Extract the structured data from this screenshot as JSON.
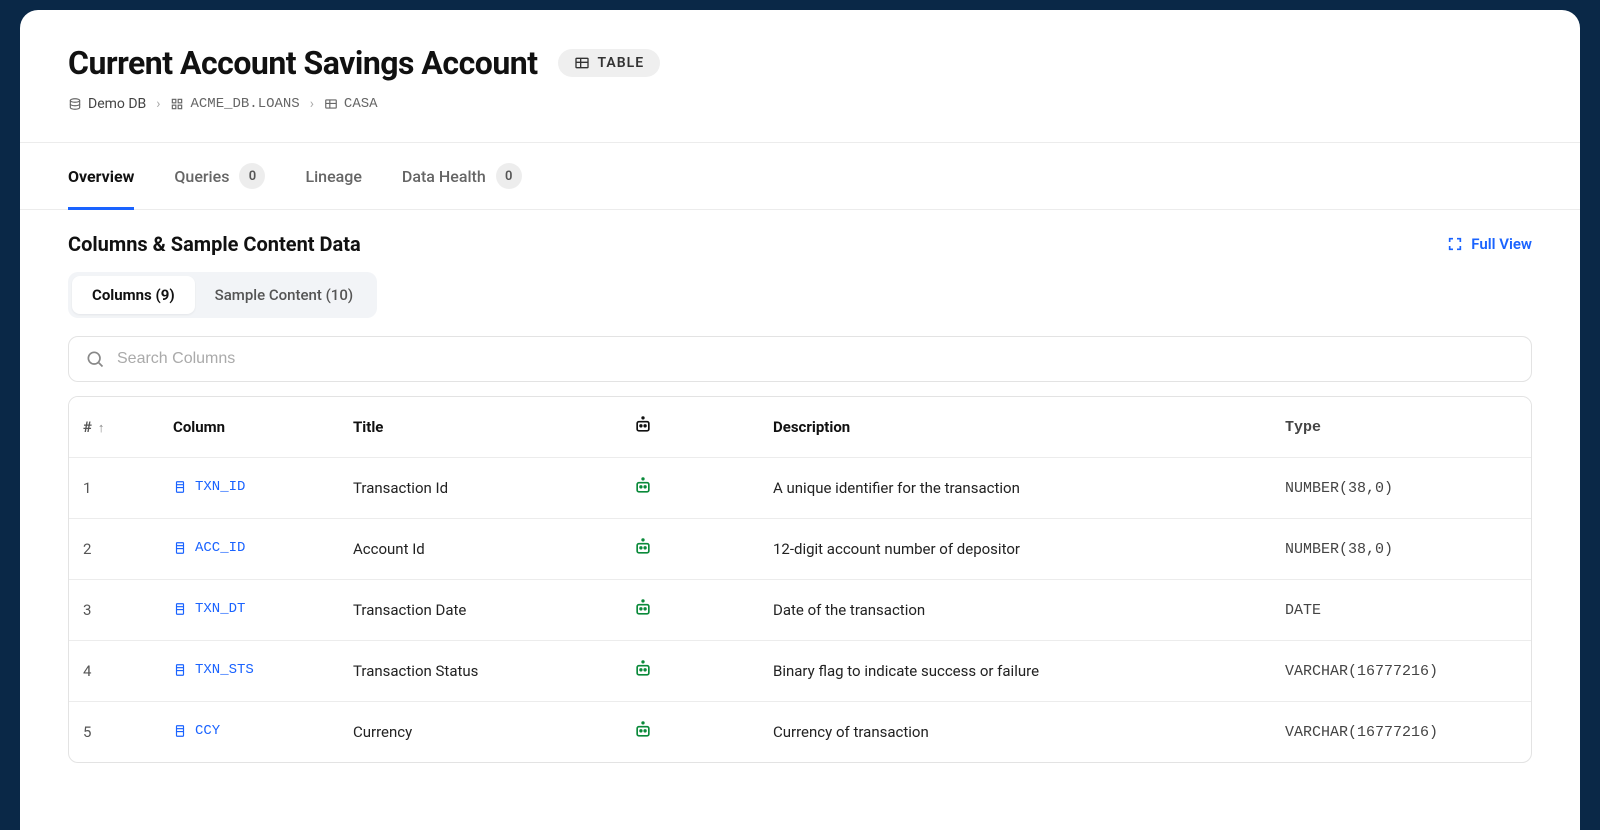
{
  "header": {
    "title": "Current Account Savings Account",
    "badge_label": "TABLE"
  },
  "breadcrumb": {
    "db": "Demo DB",
    "schema": "ACME_DB.LOANS",
    "table": "CASA"
  },
  "tabs": {
    "overview": "Overview",
    "queries": "Queries",
    "queries_count": "0",
    "lineage": "Lineage",
    "data_health": "Data Health",
    "data_health_count": "0"
  },
  "section": {
    "title": "Columns & Sample Content Data",
    "full_view": "Full View",
    "subtab_columns": "Columns (9)",
    "subtab_sample": "Sample Content (10)",
    "search_placeholder": "Search Columns"
  },
  "table": {
    "headers": {
      "num": "#",
      "column": "Column",
      "title": "Title",
      "description": "Description",
      "type": "Type"
    },
    "rows": [
      {
        "num": "1",
        "name": "TXN_ID",
        "title": "Transaction Id",
        "desc": "A unique identifier for the transaction",
        "type": "NUMBER(38,0)"
      },
      {
        "num": "2",
        "name": "ACC_ID",
        "title": "Account Id",
        "desc": "12-digit account number of depositor",
        "type": "NUMBER(38,0)"
      },
      {
        "num": "3",
        "name": "TXN_DT",
        "title": "Transaction Date",
        "desc": "Date of the transaction",
        "type": "DATE"
      },
      {
        "num": "4",
        "name": "TXN_STS",
        "title": "Transaction Status",
        "desc": "Binary flag to indicate success or failure",
        "type": "VARCHAR(16777216)"
      },
      {
        "num": "5",
        "name": "CCY",
        "title": "Currency",
        "desc": "Currency of transaction",
        "type": "VARCHAR(16777216)"
      }
    ]
  }
}
